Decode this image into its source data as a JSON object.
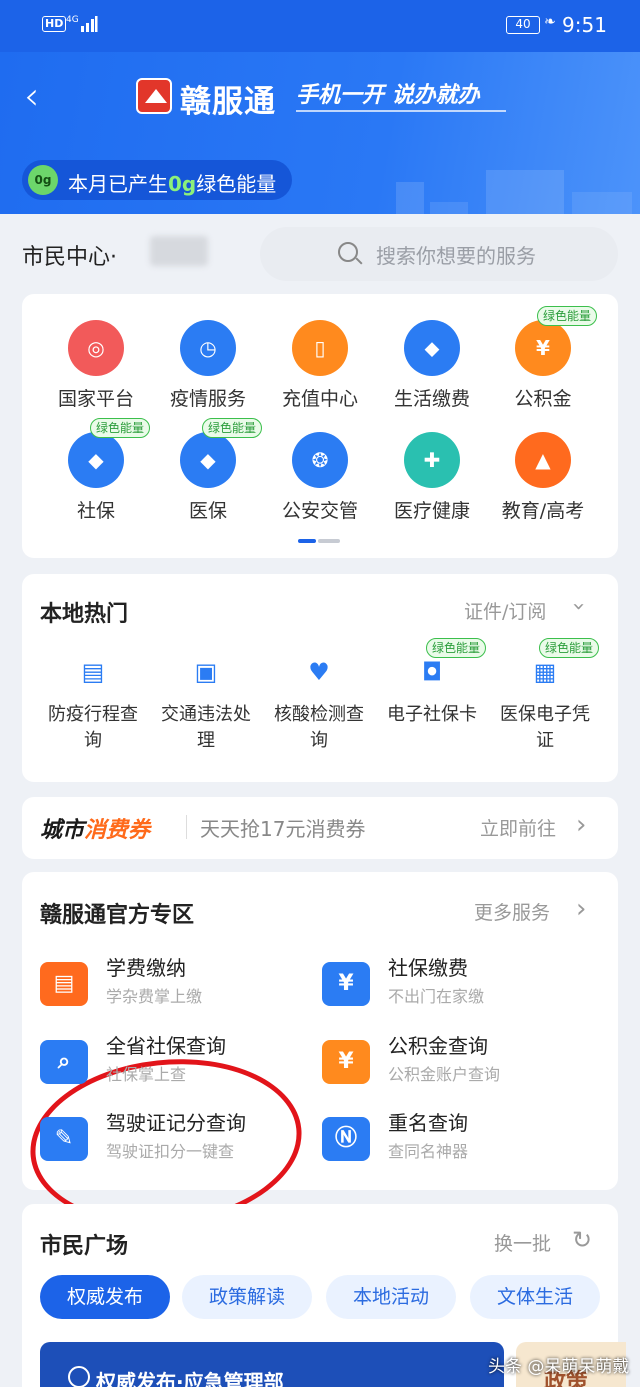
{
  "status_bar": {
    "network_badge": "HD",
    "signal_type": "4G",
    "battery": "40",
    "time": "9:51"
  },
  "header": {
    "back_icon": "chevron-left-icon",
    "app_name": "赣服通",
    "slogan": "手机一开  说办就办",
    "energy_prefix": "本月已产生",
    "energy_value": "0g",
    "energy_suffix": "绿色能量",
    "energy_badge": "0g"
  },
  "location": {
    "label": "市民中心·"
  },
  "search": {
    "placeholder": "搜索你想要的服务"
  },
  "services": [
    {
      "label": "国家平台",
      "icon": "emblem-icon",
      "color": "#f25a5a",
      "tag": ""
    },
    {
      "label": "疫情服务",
      "icon": "clock-icon",
      "color": "#2b7cf3",
      "tag": ""
    },
    {
      "label": "充值中心",
      "icon": "phone-icon",
      "color": "#ff8a1e",
      "tag": ""
    },
    {
      "label": "生活缴费",
      "icon": "drop-icon",
      "color": "#2b7cf3",
      "tag": ""
    },
    {
      "label": "公积金",
      "icon": "yen-house-icon",
      "color": "#ff8a1e",
      "tag": "绿色能量"
    },
    {
      "label": "社保",
      "icon": "shield-icon",
      "color": "#2b7cf3",
      "tag": "绿色能量"
    },
    {
      "label": "医保",
      "icon": "shield-icon",
      "color": "#2b7cf3",
      "tag": "绿色能量"
    },
    {
      "label": "公安交管",
      "icon": "police-icon",
      "color": "#2b7cf3",
      "tag": ""
    },
    {
      "label": "医疗健康",
      "icon": "medical-icon",
      "color": "#2ac0b0",
      "tag": ""
    },
    {
      "label": "教育/高考",
      "icon": "graduation-cap-icon",
      "color": "#ff6a1e",
      "tag": ""
    }
  ],
  "hot": {
    "title": "本地热门",
    "more": "证件/订阅",
    "items": [
      {
        "line1": "防疫行程查",
        "line2": "询",
        "tag": "",
        "icon": "id-card-icon"
      },
      {
        "line1": "交通违法处",
        "line2": "理",
        "tag": "",
        "icon": "car-icon"
      },
      {
        "line1": "核酸检测查",
        "line2": "询",
        "tag": "",
        "icon": "heart-plus-icon"
      },
      {
        "line1": "电子社保卡",
        "line2": "",
        "tag": "绿色能量",
        "icon": "si-card-icon"
      },
      {
        "line1": "医保电子凭",
        "line2": "证",
        "tag": "绿色能量",
        "icon": "chs-icon"
      }
    ]
  },
  "voucher": {
    "brand_a": "城市",
    "brand_b": "消费券",
    "text": "天天抢17元消费券",
    "go": "立即前往"
  },
  "official": {
    "title": "赣服通官方专区",
    "more": "更多服务",
    "items": [
      {
        "title": "学费缴纳",
        "sub": "学杂费掌上缴",
        "icon": "wallet-icon"
      },
      {
        "title": "社保缴费",
        "sub": "不出门在家缴",
        "icon": "yen-doc-icon"
      },
      {
        "title": "全省社保查询",
        "sub": "社保掌上查",
        "icon": "search-shield-icon"
      },
      {
        "title": "公积金查询",
        "sub": "公积金账户查询",
        "icon": "yen-house-icon"
      },
      {
        "title": "驾驶证记分查询",
        "sub": "驾驶证扣分一键查",
        "icon": "license-icon"
      },
      {
        "title": "重名查询",
        "sub": "查同名神器",
        "icon": "name-search-icon"
      }
    ]
  },
  "square": {
    "title": "市民广场",
    "refresh": "换一批",
    "tabs": [
      "权威发布",
      "政策解读",
      "本地活动",
      "文体生活"
    ],
    "banner_text": "权威发布·应急管理部",
    "banner2_text": "政策"
  },
  "watermark": "头条 @呆萌呆萌戴",
  "colors": {
    "primary": "#1c63e8",
    "green_tag": "#3bbf4c",
    "annotation": "#e2141a"
  }
}
